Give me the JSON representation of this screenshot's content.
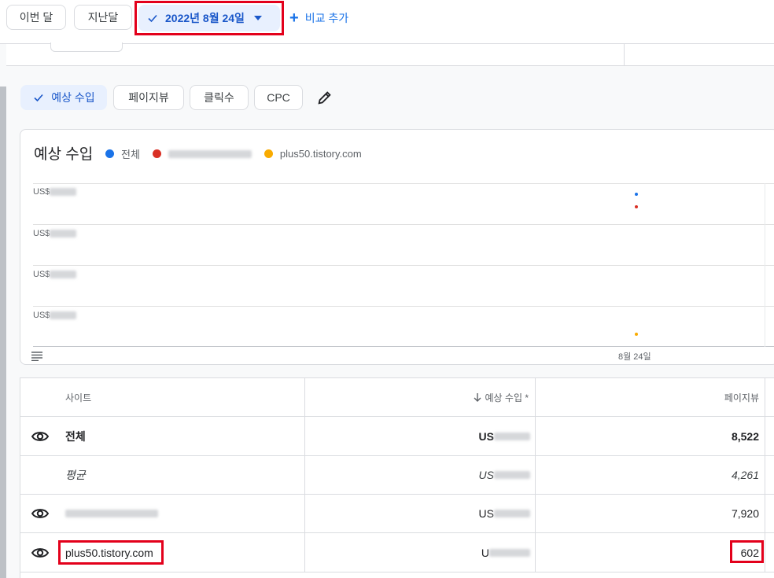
{
  "toolbar": {
    "this_month": "이번 달",
    "last_month": "지난달",
    "selected_date": "2022년 8월 24일",
    "add_compare": "비교 추가"
  },
  "metrics": {
    "revenue": "예상 수입",
    "pageviews": "페이지뷰",
    "clicks": "클릭수",
    "cpc": "CPC"
  },
  "chart": {
    "title": "예상 수입",
    "legend_total": "전체",
    "legend_site2": "plus50.tistory.com",
    "ylabels": [
      "US$",
      "US$",
      "US$",
      "US$"
    ],
    "xlabel": "8월 24일",
    "colors": {
      "total": "#1a73e8",
      "site1": "#d93025",
      "site2": "#f9ab00"
    }
  },
  "table": {
    "headers": {
      "site": "사이트",
      "revenue": "예상 수입 *",
      "pageviews": "페이지뷰"
    },
    "rows": [
      {
        "site": "전체",
        "revenue": "US",
        "pageviews": "8,522"
      },
      {
        "site": "평균",
        "revenue": "US",
        "pageviews": "4,261"
      },
      {
        "site": "",
        "revenue": "US",
        "pageviews": "7,920"
      },
      {
        "site": "plus50.tistory.com",
        "revenue": "U",
        "pageviews": "602"
      }
    ]
  }
}
